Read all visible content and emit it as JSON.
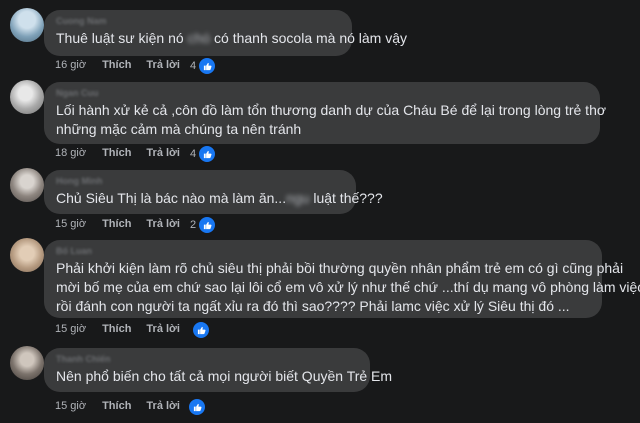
{
  "actions": {
    "like": "Thích",
    "reply": "Trả lời"
  },
  "comments": [
    {
      "author": "Cuong Nam",
      "text_before": "Thuê luật sư kiện nó ",
      "text_blurred": "chó",
      "text_after": " có thanh socola mà nó làm vậy",
      "time": "16 giờ",
      "reactions": "4"
    },
    {
      "author": "Ngan Cuu",
      "line1": "Lối hành xử kẻ cả ,côn đồ làm tổn thương danh dự của Cháu Bé để lại trong lòng trẻ thơ",
      "line2": "những mặc cảm mà chúng ta nên tránh",
      "time": "18 giờ",
      "reactions": "4"
    },
    {
      "author": "Hong Minh",
      "text_before": "Chủ Siêu Thị là bác nào mà làm ăn...",
      "text_blurred": "ngu",
      "text_after": " luật thế???",
      "time": "15 giờ",
      "reactions": "2"
    },
    {
      "author": "Bố Luan",
      "line1": "Phải khởi kiện làm rõ chủ siêu thị phải bồi thường quyền nhân phẩm trẻ em có gì cũng phải",
      "line2": "mời bố mẹ của em chứ sao lại lôi cổ em vô xử lý như thế chứ ...thí dụ mang vô phòng làm việc",
      "line3": "rồi đánh con người ta ngất xỉu ra đó thì sao???? Phải lamc việc xử lý Siêu thị đó ...",
      "time": "15 giờ",
      "reactions": ""
    },
    {
      "author": "Thanh Chiến",
      "text": "Nên phổ biến cho tất cả mọi người biết Quyền Trẻ Em",
      "time": "15 giờ",
      "reactions": ""
    }
  ],
  "colors": {
    "background": "#18191a",
    "bubble": "#3a3b3c",
    "text": "#e4e6eb",
    "secondary_text": "#b0b3b8",
    "like_blue": "#1877f2"
  }
}
